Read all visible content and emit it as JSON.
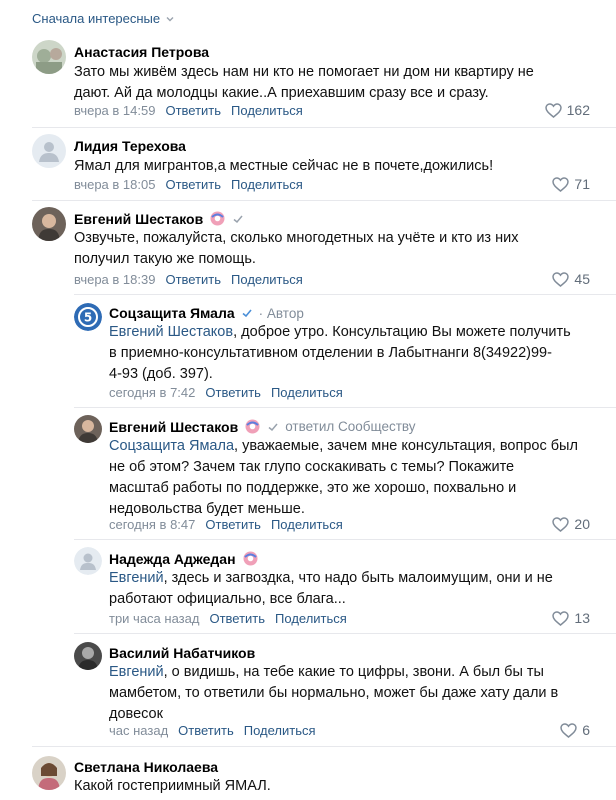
{
  "sort_label": "Сначала интересные",
  "comments": [
    {
      "author": "Анастасия Петрова",
      "text_lines": [
        "Зато мы живём здесь нам ни кто не помогает ни дом ни квартиру не",
        "дают. Ай да молодцы какие..А приехавшим сразу все и сразу."
      ],
      "time": "вчера в 14:59",
      "reply": "Ответить",
      "share": "Поделиться",
      "likes": "162"
    },
    {
      "author": "Лидия Терехова",
      "text_lines": [
        "Ямал для мигрантов,а местные сейчас не в почете,дожились!"
      ],
      "time": "вчера в 18:05",
      "reply": "Ответить",
      "share": "Поделиться",
      "likes": "71"
    },
    {
      "author": "Евгений Шестаков",
      "text_lines": [
        "Озвучьте, пожалуйста, сколько многодетных на учёте и кто из них",
        "получил такую же помощь."
      ],
      "time": "вчера в 18:39",
      "reply": "Ответить",
      "share": "Поделиться",
      "likes": "45"
    },
    {
      "author": "Соцзащита Ямала",
      "author_meta": "· Автор",
      "mention": "Евгений Шестаков",
      "text_lines": [
        ", доброе утро. Консультацию Вы можете получить",
        "в приемно-консультативном отделении в Лабытнанги 8(34922)99-",
        "4-93 (доб. 397)."
      ],
      "time": "сегодня в 7:42",
      "reply": "Ответить",
      "share": "Поделиться"
    },
    {
      "author": "Евгений Шестаков",
      "author_meta": "ответил Сообществу",
      "mention": "Соцзащита Ямала",
      "text_lines": [
        ", уважаемые, зачем мне консультация, вопрос был",
        "не об этом? Зачем так глупо соскакивать с темы? Покажите",
        "масштаб работы по поддержке, это же хорошо, похвально и",
        "недовольства будет меньше."
      ],
      "time": "сегодня в 8:47",
      "reply": "Ответить",
      "share": "Поделиться",
      "likes": "20"
    },
    {
      "author": "Надежда Аджедан",
      "mention": "Евгений",
      "text_lines": [
        ", здесь и загвоздка, что надо быть малоимущим, они и не",
        "работают официально, все блага..."
      ],
      "time": "три часа назад",
      "reply": "Ответить",
      "share": "Поделиться",
      "likes": "13"
    },
    {
      "author": "Василий Набатчиков",
      "mention": "Евгений",
      "text_lines": [
        ", о видишь, на тебе какие то цифры, звони. А был бы ты",
        "мамбетом, то ответили бы нормально, может бы даже хату дали в",
        "довесок"
      ],
      "time": "час назад",
      "reply": "Ответить",
      "share": "Поделиться",
      "likes": "6"
    },
    {
      "author": "Светлана Николаева",
      "text_lines": [
        "Какой гостеприимный ЯМАЛ."
      ]
    }
  ],
  "colors": {
    "link": "#2a5885",
    "meta": "#818c99",
    "separator": "#e7e8ec"
  },
  "icons": {
    "sort": "chevron-down-icon",
    "like": "heart-icon",
    "verified": "checkmark-icon",
    "donut": "donut-badge-icon"
  }
}
